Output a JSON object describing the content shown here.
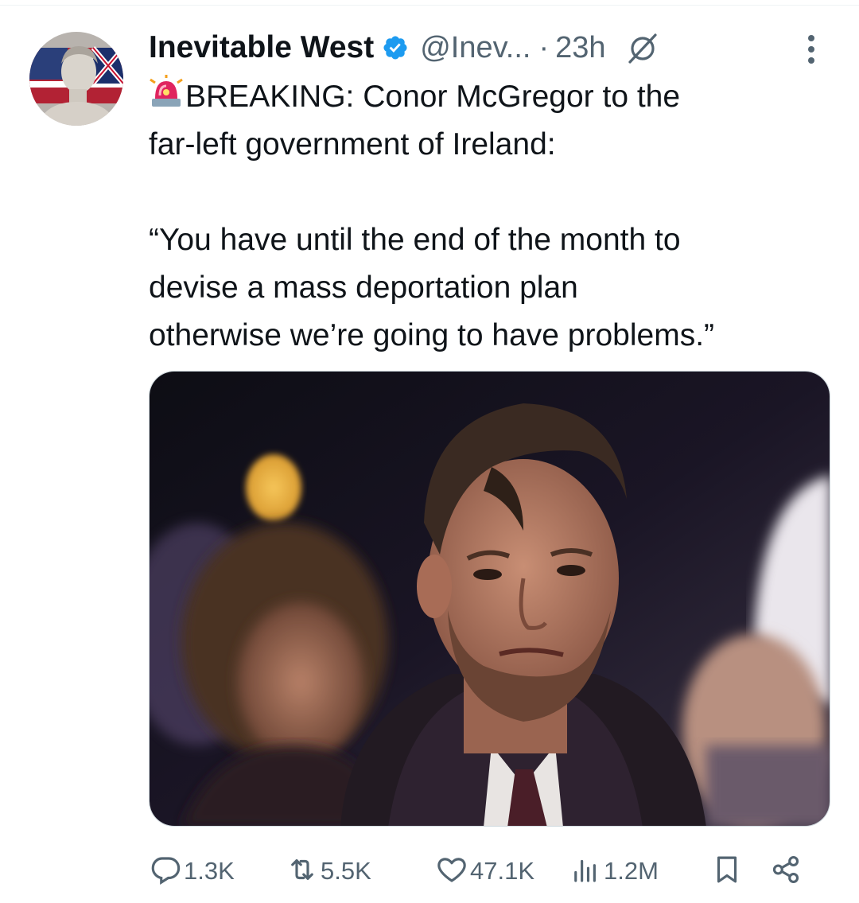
{
  "tweet": {
    "author_name": "Inevitable West",
    "handle": "@Inev...",
    "separator": "·",
    "time": "23h",
    "text_line_1": "BREAKING: Conor McGregor to the",
    "text_rest": "far-left government of Ireland:\n\n“You have until the end of the month to\ndevise a mass deportation plan\notherwise we’re going to have problems.”"
  },
  "actions": {
    "replies": "1.3K",
    "reposts": "5.5K",
    "likes": "47.1K",
    "views": "1.2M"
  },
  "icons": {
    "verified": "verified-badge-icon",
    "grok": "grok-icon",
    "more": "more-options-icon",
    "siren": "police-light-emoji",
    "reply": "reply-icon",
    "repost": "repost-icon",
    "like": "heart-icon",
    "views": "views-icon",
    "bookmark": "bookmark-icon",
    "share": "share-icon"
  },
  "colors": {
    "text_primary": "#0f1419",
    "text_secondary": "#536471",
    "verified_blue": "#1d9bf0"
  }
}
